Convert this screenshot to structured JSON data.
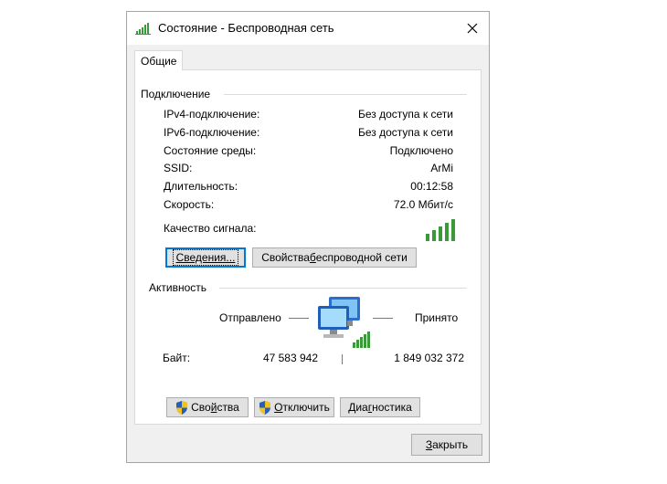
{
  "window": {
    "title": "Состояние - Беспроводная сеть",
    "tab_label": "Общие"
  },
  "connection": {
    "group_title": "Подключение",
    "rows": [
      {
        "label": "IPv4-подключение:",
        "value": "Без доступа к сети"
      },
      {
        "label": "IPv6-подключение:",
        "value": "Без доступа к сети"
      },
      {
        "label": "Состояние среды:",
        "value": "Подключено"
      },
      {
        "label": "SSID:",
        "value": "ArMi"
      },
      {
        "label": "Длительность:",
        "value": "00:12:58"
      },
      {
        "label": "Скорость:",
        "value": "72.0 Мбит/с"
      }
    ],
    "signal_label": "Качество сигнала:",
    "signal_bars": 5,
    "details_button": "Сведения...",
    "wireless_props_button": {
      "pre": "Свойства ",
      "ul": "б",
      "post": "еспроводной сети"
    }
  },
  "activity": {
    "group_title": "Активность",
    "sent_label": "Отправлено",
    "received_label": "Принято",
    "bytes_label": "Байт:",
    "bytes_sent": "47 583 942",
    "bytes_received": "1 849 032 372"
  },
  "buttons": {
    "properties": {
      "pre": "Сво",
      "ul": "й",
      "post": "ства"
    },
    "disable": {
      "pre": "",
      "ul": "О",
      "post": "тключить"
    },
    "diagnose": {
      "pre": "Диа",
      "ul": "г",
      "post": "ностика"
    },
    "close": {
      "pre": "",
      "ul": "З",
      "post": "акрыть"
    }
  },
  "colors": {
    "signal_green": "#3a9a3a",
    "accent_blue": "#0078d7",
    "shield_blue": "#2a5fb8",
    "shield_yellow": "#f3c21b"
  }
}
